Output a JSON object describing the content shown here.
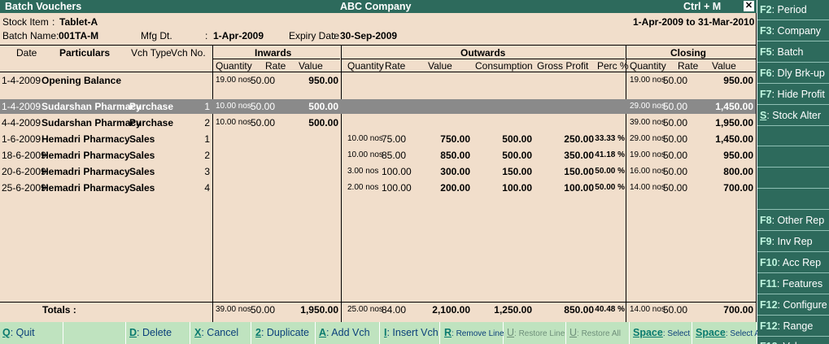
{
  "window": {
    "title": "Batch Vouchers",
    "company": "ABC Company",
    "shortcut": "Ctrl + M",
    "close": "✕"
  },
  "header": {
    "stock_item_label": "Stock Item",
    "stock_item_value": "Tablet-A",
    "batch_name_label": "Batch Name:",
    "batch_name_value": "001TA-M",
    "mfg_label": "Mfg Dt.",
    "mfg_value": "1-Apr-2009",
    "expiry_label": "Expiry Date",
    "expiry_value": "30-Sep-2009",
    "period": "1-Apr-2009 to 31-Mar-2010",
    "colon": ":"
  },
  "columns": {
    "date": "Date",
    "particulars": "Particulars",
    "vch_type": "Vch Type",
    "vch_no": "Vch No.",
    "inwards": "Inwards",
    "outwards": "Outwards",
    "closing": "Closing",
    "quantity": "Quantity",
    "rate": "Rate",
    "value": "Value",
    "consumption": "Consumption",
    "gross_profit": "Gross Profit",
    "perc": "Perc %"
  },
  "rows": [
    {
      "date": "1-4-2009",
      "particulars": "Opening Balance",
      "vch_type": "",
      "vch_no": "",
      "in_qty": "19.00 nos",
      "in_rate": "50.00",
      "in_value": "950.00",
      "out_qty": "",
      "out_rate": "",
      "out_value": "",
      "consumption": "",
      "gross_profit": "",
      "perc": "",
      "cl_qty": "19.00 nos",
      "cl_rate": "50.00",
      "cl_value": "950.00"
    },
    {
      "date": "1-4-2009",
      "particulars": "Sudarshan Pharmacy",
      "vch_type": "Purchase",
      "vch_no": "1",
      "in_qty": "10.00 nos",
      "in_rate": "50.00",
      "in_value": "500.00",
      "out_qty": "",
      "out_rate": "",
      "out_value": "",
      "consumption": "",
      "gross_profit": "",
      "perc": "",
      "cl_qty": "29.00 nos",
      "cl_rate": "50.00",
      "cl_value": "1,450.00",
      "selected": true
    },
    {
      "date": "4-4-2009",
      "particulars": "Sudarshan Pharmacy",
      "vch_type": "Purchase",
      "vch_no": "2",
      "in_qty": "10.00 nos",
      "in_rate": "50.00",
      "in_value": "500.00",
      "out_qty": "",
      "out_rate": "",
      "out_value": "",
      "consumption": "",
      "gross_profit": "",
      "perc": "",
      "cl_qty": "39.00 nos",
      "cl_rate": "50.00",
      "cl_value": "1,950.00"
    },
    {
      "date": "1-6-2009",
      "particulars": "Hemadri Pharmacy",
      "vch_type": "Sales",
      "vch_no": "1",
      "in_qty": "",
      "in_rate": "",
      "in_value": "",
      "out_qty": "10.00 nos",
      "out_rate": "75.00",
      "out_value": "750.00",
      "consumption": "500.00",
      "gross_profit": "250.00",
      "perc": "33.33 %",
      "cl_qty": "29.00 nos",
      "cl_rate": "50.00",
      "cl_value": "1,450.00"
    },
    {
      "date": "18-6-2009",
      "particulars": "Hemadri Pharmacy",
      "vch_type": "Sales",
      "vch_no": "2",
      "in_qty": "",
      "in_rate": "",
      "in_value": "",
      "out_qty": "10.00 nos",
      "out_rate": "85.00",
      "out_value": "850.00",
      "consumption": "500.00",
      "gross_profit": "350.00",
      "perc": "41.18 %",
      "cl_qty": "19.00 nos",
      "cl_rate": "50.00",
      "cl_value": "950.00"
    },
    {
      "date": "20-6-2009",
      "particulars": "Hemadri Pharmacy",
      "vch_type": "Sales",
      "vch_no": "3",
      "in_qty": "",
      "in_rate": "",
      "in_value": "",
      "out_qty": "3.00 nos",
      "out_rate": "100.00",
      "out_value": "300.00",
      "consumption": "150.00",
      "gross_profit": "150.00",
      "perc": "50.00 %",
      "cl_qty": "16.00 nos",
      "cl_rate": "50.00",
      "cl_value": "800.00"
    },
    {
      "date": "25-6-2009",
      "particulars": "Hemadri Pharmacy",
      "vch_type": "Sales",
      "vch_no": "4",
      "in_qty": "",
      "in_rate": "",
      "in_value": "",
      "out_qty": "2.00 nos",
      "out_rate": "100.00",
      "out_value": "200.00",
      "consumption": "100.00",
      "gross_profit": "100.00",
      "perc": "50.00 %",
      "cl_qty": "14.00 nos",
      "cl_rate": "50.00",
      "cl_value": "700.00"
    }
  ],
  "totals": {
    "label": "Totals :",
    "in_qty": "39.00 nos",
    "in_rate": "50.00",
    "in_value": "1,950.00",
    "out_qty": "25.00 nos",
    "out_rate": "84.00",
    "out_value": "2,100.00",
    "consumption": "1,250.00",
    "gross_profit": "850.00",
    "perc": "40.48 %",
    "cl_qty": "14.00 nos",
    "cl_rate": "50.00",
    "cl_value": "700.00"
  },
  "bottom_buttons": [
    {
      "key": "Q",
      "label": ": Quit",
      "enabled": true
    },
    {
      "key": "D",
      "label": ": Delete",
      "enabled": true
    },
    {
      "key": "X",
      "label": ": Cancel",
      "enabled": true
    },
    {
      "key": "2",
      "label": ": Duplicate",
      "enabled": true
    },
    {
      "key": "A",
      "label": ": Add Vch",
      "enabled": true
    },
    {
      "key": "I",
      "label": ": Insert Vch",
      "enabled": true
    },
    {
      "key": "R",
      "label": ": Remove Line",
      "enabled": true
    },
    {
      "key": "U",
      "label": ": Restore Line",
      "enabled": false
    },
    {
      "key": "U",
      "label": ": Restore All",
      "enabled": false
    },
    {
      "key": "Space",
      "label": ": Select",
      "enabled": true
    },
    {
      "key": "Space",
      "label": ": Select All",
      "enabled": true
    }
  ],
  "sidebar": [
    {
      "key": "F2",
      "label": ": Period",
      "underline": false
    },
    {
      "key": "F3",
      "label": ": Company",
      "underline": false
    },
    {
      "key": "F5",
      "label": ": Batch",
      "underline": false
    },
    {
      "key": "F6",
      "label": ": Dly Brk-up",
      "underline": false
    },
    {
      "key": "F7",
      "label": ": Hide Profit",
      "underline": false
    },
    {
      "key": "S",
      "label": ": Stock Alter",
      "underline": true
    },
    {
      "key": "",
      "label": "",
      "underline": false
    },
    {
      "key": "",
      "label": "",
      "underline": false
    },
    {
      "key": "",
      "label": "",
      "underline": false
    },
    {
      "key": "",
      "label": "",
      "underline": false
    },
    {
      "key": "F8",
      "label": ": Other Rep",
      "underline": false
    },
    {
      "key": "F9",
      "label": ": Inv Rep",
      "underline": false
    },
    {
      "key": "F10",
      "label": ": Acc Rep",
      "underline": false
    },
    {
      "key": "F11",
      "label": ": Features",
      "underline": false
    },
    {
      "key": "F12",
      "label": ": Configure",
      "underline": false
    },
    {
      "key": "F12",
      "label": ": Range",
      "underline": false
    },
    {
      "key": "F12",
      "label": ": Value",
      "underline": false
    }
  ]
}
